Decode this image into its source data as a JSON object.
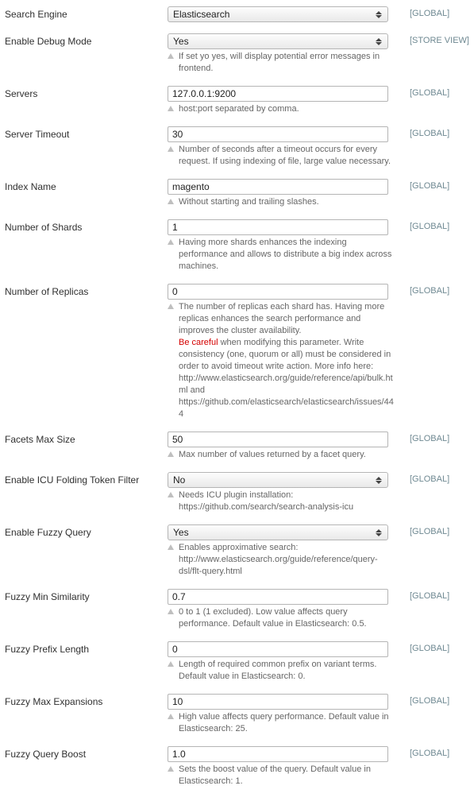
{
  "scopes": {
    "global": "[GLOBAL]",
    "store_view": "[STORE VIEW]"
  },
  "fields": {
    "search_engine": {
      "label": "Search Engine",
      "value": "Elasticsearch"
    },
    "debug": {
      "label": "Enable Debug Mode",
      "value": "Yes",
      "hint": "If set yo yes, will display potential error messages in frontend."
    },
    "servers": {
      "label": "Servers",
      "value": "127.0.0.1:9200",
      "hint": "host:port separated by comma."
    },
    "timeout": {
      "label": "Server Timeout",
      "value": "30",
      "hint": "Number of seconds after a timeout occurs for every request. If using indexing of file, large value necessary."
    },
    "index": {
      "label": "Index Name",
      "value": "magento",
      "hint": "Without starting and trailing slashes."
    },
    "shards": {
      "label": "Number of Shards",
      "value": "1",
      "hint": "Having more shards enhances the indexing performance and allows to distribute a big index across machines."
    },
    "replicas": {
      "label": "Number of Replicas",
      "value": "0",
      "hint_a": "The number of replicas each shard has. Having more replicas enhances the search performance and improves the cluster availability.",
      "warn": "Be careful",
      "hint_b": " when modifying this parameter. Write consistency (one, quorum or all) must be considered in order to avoid timeout write action. More info here: http://www.elasticsearch.org/guide/reference/api/bulk.html and https://github.com/elasticsearch/elasticsearch/issues/444"
    },
    "facets": {
      "label": "Facets Max Size",
      "value": "50",
      "hint": "Max number of values returned by a facet query."
    },
    "icu": {
      "label": "Enable ICU Folding Token Filter",
      "value": "No",
      "hint": "Needs ICU plugin installation: https://github.com/search/search-analysis-icu"
    },
    "fuzzy": {
      "label": "Enable Fuzzy Query",
      "value": "Yes",
      "hint": "Enables approximative search: http://www.elasticsearch.org/guide/reference/query-dsl/flt-query.html"
    },
    "fuzzy_sim": {
      "label": "Fuzzy Min Similarity",
      "value": "0.7",
      "hint": "0 to 1 (1 excluded). Low value affects query performance. Default value in Elasticsearch: 0.5."
    },
    "fuzzy_prefix": {
      "label": "Fuzzy Prefix Length",
      "value": "0",
      "hint": "Length of required common prefix on variant terms. Default value in Elasticsearch: 0."
    },
    "fuzzy_max": {
      "label": "Fuzzy Max Expansions",
      "value": "10",
      "hint": "High value affects query performance. Default value in Elasticsearch: 25."
    },
    "fuzzy_boost": {
      "label": "Fuzzy Query Boost",
      "value": "1.0",
      "hint": "Sets the boost value of the query. Default value in Elasticsearch: 1."
    }
  }
}
